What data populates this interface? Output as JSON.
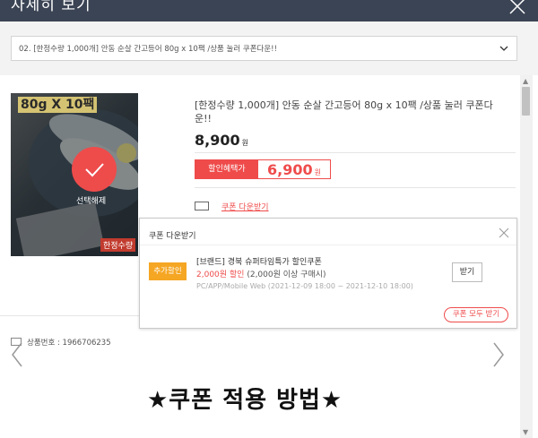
{
  "window": {
    "title": "자세히 보기",
    "close_icon": "close-icon"
  },
  "option_select": {
    "selected": "02. [한정수량 1,000개] 안동 순살 간고등어 80g x 10팩 /상품 눌러 쿠폰다운!!",
    "chevron_icon": "chevron-down-icon"
  },
  "product": {
    "image_label": "80g X 10팩",
    "image_deselect": "선택해제",
    "image_brand": "한정수량",
    "name": "[한정수량 1,000개] 안동 순살 간고등어 80g x 10팩 /상품 눌러 쿠폰다운!!",
    "price": "8,900",
    "price_unit": "원",
    "sale_label": "할인혜택가",
    "sale_price": "6,900",
    "sale_unit": "원",
    "coupon_link": "쿠폰 다운받기",
    "number_label": "상품번호 : 1966706235"
  },
  "coupon_popup": {
    "title": "쿠폰 다운받기",
    "badge": "추가할인",
    "coupon_name": "[브랜드] 경북 슈퍼타임특가 할인쿠폰",
    "amount": "2,000원 할인",
    "condition": " (2,000원 이상 구매시)",
    "date": "PC/APP/Mobile Web (2021-12-09 18:00 ~ 2021-12-10 18:00)",
    "get_button": "받기",
    "all_button": "쿠폰 모두 받기"
  },
  "detail": {
    "heading": "★쿠폰 적용 방법★"
  },
  "colors": {
    "titlebar": "#3b4454",
    "accent_red": "#ef4b4b",
    "badge_orange": "#f5a623"
  }
}
